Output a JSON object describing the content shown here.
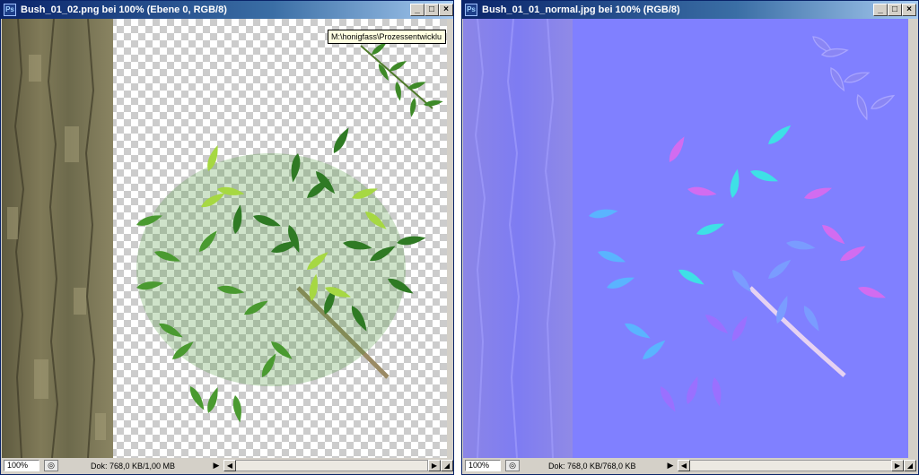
{
  "left_window": {
    "title": "Bush_01_02.png bei 100% (Ebene 0, RGB/8)",
    "tooltip": "M:\\honigfass\\Prozessentwicklu",
    "zoom": "100%",
    "doc_info": "Dok: 768,0 KB/1,00 MB"
  },
  "right_window": {
    "title": "Bush_01_01_normal.jpg bei 100% (RGB/8)",
    "zoom": "100%",
    "doc_info": "Dok: 768,0 KB/768,0 KB"
  },
  "buttons": {
    "minimize": "_",
    "maximize": "□",
    "close": "×"
  },
  "icons": {
    "app": "photoshop-doc-icon",
    "nav": "nav-arrow-right-icon",
    "status": "status-icon"
  },
  "colors": {
    "title_bar": "#0a246a",
    "bark": "#6b6648",
    "leaf_dark": "#3d8a2a",
    "leaf_light": "#a6d842",
    "normal_bg": "#8080ff"
  }
}
